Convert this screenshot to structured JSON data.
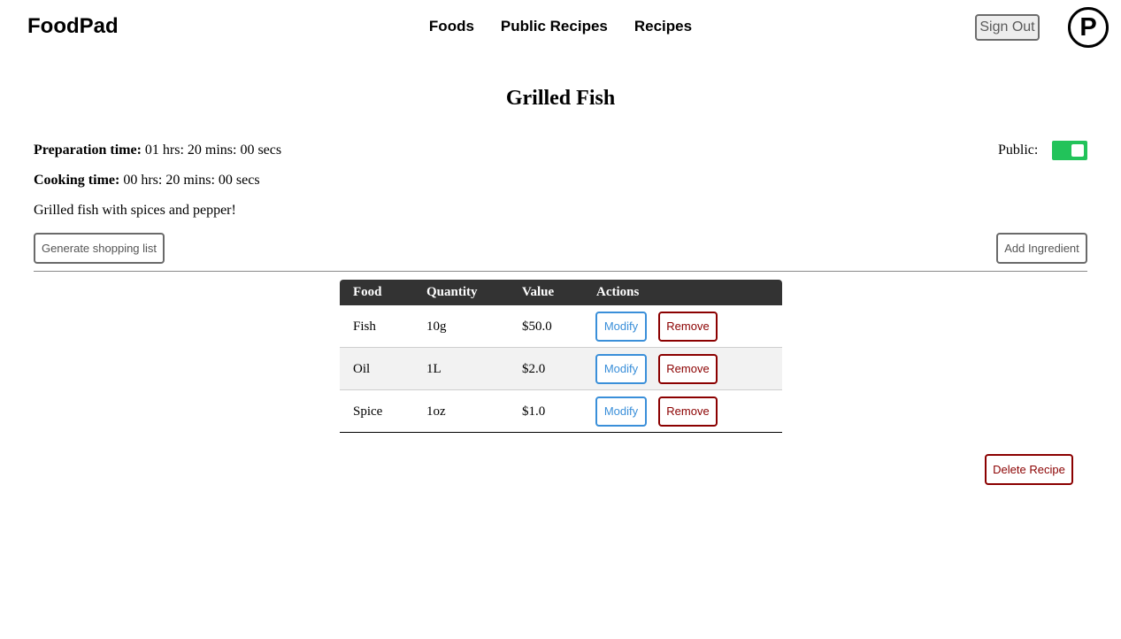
{
  "header": {
    "brand": "FoodPad",
    "nav": [
      {
        "label": "Foods"
      },
      {
        "label": "Public Recipes"
      },
      {
        "label": "Recipes"
      }
    ],
    "sign_out": "Sign Out",
    "avatar_letter": "P"
  },
  "recipe": {
    "title": "Grilled Fish",
    "prep_label": "Preparation time:",
    "prep_value": "01 hrs: 20 mins: 00 secs",
    "cook_label": "Cooking time:",
    "cook_value": "00 hrs: 20 mins: 00 secs",
    "description": "Grilled fish with spices and pepper!",
    "public_label": "Public:",
    "public_on": true,
    "toggle_color": "#22c35a"
  },
  "actions": {
    "generate_shopping_list": "Generate shopping list",
    "add_ingredient": "Add Ingredient",
    "delete_recipe": "Delete Recipe"
  },
  "table": {
    "headers": [
      "Food",
      "Quantity",
      "Value",
      "Actions"
    ],
    "rows": [
      {
        "food": "Fish",
        "quantity": "10g",
        "value": "$50.0",
        "modify": "Modify",
        "remove": "Remove"
      },
      {
        "food": "Oil",
        "quantity": "1L",
        "value": "$2.0",
        "modify": "Modify",
        "remove": "Remove"
      },
      {
        "food": "Spice",
        "quantity": "1oz",
        "value": "$1.0",
        "modify": "Modify",
        "remove": "Remove"
      }
    ]
  },
  "colors": {
    "modify_blue": "#3a8fd9",
    "remove_red": "#8b0000",
    "table_header": "#333333"
  }
}
